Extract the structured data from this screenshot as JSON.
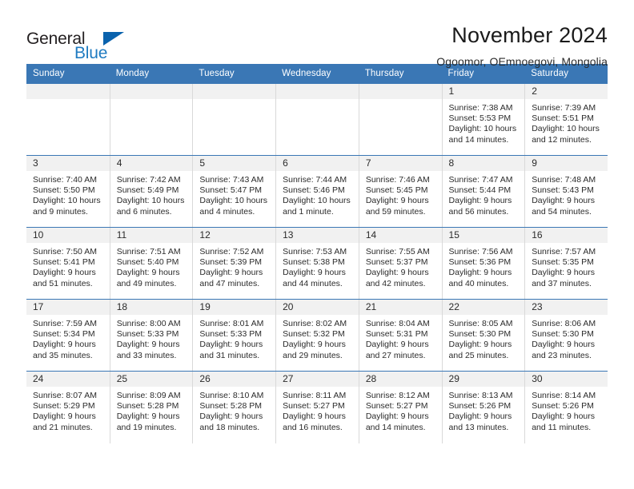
{
  "brand": {
    "general": "General",
    "blue": "Blue",
    "triangle_color": "#0a62ad",
    "blue_color": "#1f7bc1"
  },
  "header": {
    "title": "November 2024",
    "subtitle": "Ogoomor, OEmnoegovi, Mongolia"
  },
  "theme": {
    "header_bar": "#3a77b5",
    "daynum_bar": "#f1f1f1",
    "cell_divider": "#d9d9d9",
    "text": "#2b2b2b"
  },
  "weekdays": [
    "Sunday",
    "Monday",
    "Tuesday",
    "Wednesday",
    "Thursday",
    "Friday",
    "Saturday"
  ],
  "weeks": [
    [
      {
        "empty": true
      },
      {
        "empty": true
      },
      {
        "empty": true
      },
      {
        "empty": true
      },
      {
        "empty": true
      },
      {
        "day": "1",
        "sunrise": "Sunrise: 7:38 AM",
        "sunset": "Sunset: 5:53 PM",
        "daylight1": "Daylight: 10 hours",
        "daylight2": "and 14 minutes."
      },
      {
        "day": "2",
        "sunrise": "Sunrise: 7:39 AM",
        "sunset": "Sunset: 5:51 PM",
        "daylight1": "Daylight: 10 hours",
        "daylight2": "and 12 minutes."
      }
    ],
    [
      {
        "day": "3",
        "sunrise": "Sunrise: 7:40 AM",
        "sunset": "Sunset: 5:50 PM",
        "daylight1": "Daylight: 10 hours",
        "daylight2": "and 9 minutes."
      },
      {
        "day": "4",
        "sunrise": "Sunrise: 7:42 AM",
        "sunset": "Sunset: 5:49 PM",
        "daylight1": "Daylight: 10 hours",
        "daylight2": "and 6 minutes."
      },
      {
        "day": "5",
        "sunrise": "Sunrise: 7:43 AM",
        "sunset": "Sunset: 5:47 PM",
        "daylight1": "Daylight: 10 hours",
        "daylight2": "and 4 minutes."
      },
      {
        "day": "6",
        "sunrise": "Sunrise: 7:44 AM",
        "sunset": "Sunset: 5:46 PM",
        "daylight1": "Daylight: 10 hours",
        "daylight2": "and 1 minute."
      },
      {
        "day": "7",
        "sunrise": "Sunrise: 7:46 AM",
        "sunset": "Sunset: 5:45 PM",
        "daylight1": "Daylight: 9 hours",
        "daylight2": "and 59 minutes."
      },
      {
        "day": "8",
        "sunrise": "Sunrise: 7:47 AM",
        "sunset": "Sunset: 5:44 PM",
        "daylight1": "Daylight: 9 hours",
        "daylight2": "and 56 minutes."
      },
      {
        "day": "9",
        "sunrise": "Sunrise: 7:48 AM",
        "sunset": "Sunset: 5:43 PM",
        "daylight1": "Daylight: 9 hours",
        "daylight2": "and 54 minutes."
      }
    ],
    [
      {
        "day": "10",
        "sunrise": "Sunrise: 7:50 AM",
        "sunset": "Sunset: 5:41 PM",
        "daylight1": "Daylight: 9 hours",
        "daylight2": "and 51 minutes."
      },
      {
        "day": "11",
        "sunrise": "Sunrise: 7:51 AM",
        "sunset": "Sunset: 5:40 PM",
        "daylight1": "Daylight: 9 hours",
        "daylight2": "and 49 minutes."
      },
      {
        "day": "12",
        "sunrise": "Sunrise: 7:52 AM",
        "sunset": "Sunset: 5:39 PM",
        "daylight1": "Daylight: 9 hours",
        "daylight2": "and 47 minutes."
      },
      {
        "day": "13",
        "sunrise": "Sunrise: 7:53 AM",
        "sunset": "Sunset: 5:38 PM",
        "daylight1": "Daylight: 9 hours",
        "daylight2": "and 44 minutes."
      },
      {
        "day": "14",
        "sunrise": "Sunrise: 7:55 AM",
        "sunset": "Sunset: 5:37 PM",
        "daylight1": "Daylight: 9 hours",
        "daylight2": "and 42 minutes."
      },
      {
        "day": "15",
        "sunrise": "Sunrise: 7:56 AM",
        "sunset": "Sunset: 5:36 PM",
        "daylight1": "Daylight: 9 hours",
        "daylight2": "and 40 minutes."
      },
      {
        "day": "16",
        "sunrise": "Sunrise: 7:57 AM",
        "sunset": "Sunset: 5:35 PM",
        "daylight1": "Daylight: 9 hours",
        "daylight2": "and 37 minutes."
      }
    ],
    [
      {
        "day": "17",
        "sunrise": "Sunrise: 7:59 AM",
        "sunset": "Sunset: 5:34 PM",
        "daylight1": "Daylight: 9 hours",
        "daylight2": "and 35 minutes."
      },
      {
        "day": "18",
        "sunrise": "Sunrise: 8:00 AM",
        "sunset": "Sunset: 5:33 PM",
        "daylight1": "Daylight: 9 hours",
        "daylight2": "and 33 minutes."
      },
      {
        "day": "19",
        "sunrise": "Sunrise: 8:01 AM",
        "sunset": "Sunset: 5:33 PM",
        "daylight1": "Daylight: 9 hours",
        "daylight2": "and 31 minutes."
      },
      {
        "day": "20",
        "sunrise": "Sunrise: 8:02 AM",
        "sunset": "Sunset: 5:32 PM",
        "daylight1": "Daylight: 9 hours",
        "daylight2": "and 29 minutes."
      },
      {
        "day": "21",
        "sunrise": "Sunrise: 8:04 AM",
        "sunset": "Sunset: 5:31 PM",
        "daylight1": "Daylight: 9 hours",
        "daylight2": "and 27 minutes."
      },
      {
        "day": "22",
        "sunrise": "Sunrise: 8:05 AM",
        "sunset": "Sunset: 5:30 PM",
        "daylight1": "Daylight: 9 hours",
        "daylight2": "and 25 minutes."
      },
      {
        "day": "23",
        "sunrise": "Sunrise: 8:06 AM",
        "sunset": "Sunset: 5:30 PM",
        "daylight1": "Daylight: 9 hours",
        "daylight2": "and 23 minutes."
      }
    ],
    [
      {
        "day": "24",
        "sunrise": "Sunrise: 8:07 AM",
        "sunset": "Sunset: 5:29 PM",
        "daylight1": "Daylight: 9 hours",
        "daylight2": "and 21 minutes."
      },
      {
        "day": "25",
        "sunrise": "Sunrise: 8:09 AM",
        "sunset": "Sunset: 5:28 PM",
        "daylight1": "Daylight: 9 hours",
        "daylight2": "and 19 minutes."
      },
      {
        "day": "26",
        "sunrise": "Sunrise: 8:10 AM",
        "sunset": "Sunset: 5:28 PM",
        "daylight1": "Daylight: 9 hours",
        "daylight2": "and 18 minutes."
      },
      {
        "day": "27",
        "sunrise": "Sunrise: 8:11 AM",
        "sunset": "Sunset: 5:27 PM",
        "daylight1": "Daylight: 9 hours",
        "daylight2": "and 16 minutes."
      },
      {
        "day": "28",
        "sunrise": "Sunrise: 8:12 AM",
        "sunset": "Sunset: 5:27 PM",
        "daylight1": "Daylight: 9 hours",
        "daylight2": "and 14 minutes."
      },
      {
        "day": "29",
        "sunrise": "Sunrise: 8:13 AM",
        "sunset": "Sunset: 5:26 PM",
        "daylight1": "Daylight: 9 hours",
        "daylight2": "and 13 minutes."
      },
      {
        "day": "30",
        "sunrise": "Sunrise: 8:14 AM",
        "sunset": "Sunset: 5:26 PM",
        "daylight1": "Daylight: 9 hours",
        "daylight2": "and 11 minutes."
      }
    ]
  ]
}
